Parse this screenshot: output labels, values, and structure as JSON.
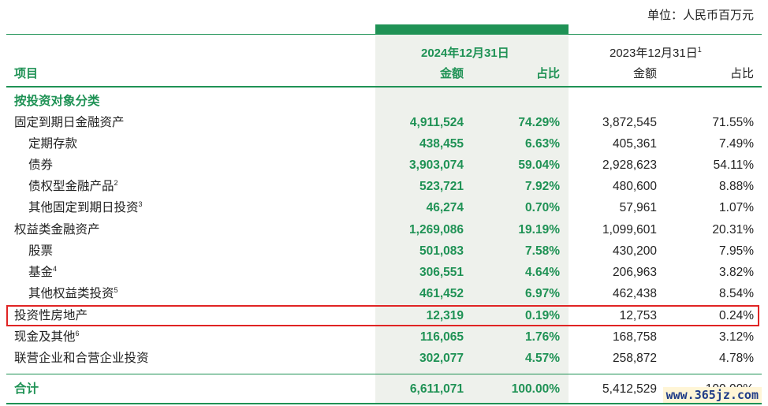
{
  "unit": "单位：人民币百万元",
  "header": {
    "item": "项目",
    "period_2024": "2024年12月31日",
    "period_2023": "2023年12月31日",
    "period_2023_note": "1",
    "amount": "金额",
    "ratio": "占比"
  },
  "rows": [
    {
      "label": "按投资对象分类",
      "note": "",
      "a24": "",
      "p24": "",
      "a23": "",
      "p23": ""
    },
    {
      "label": "固定到期日金融资产",
      "note": "",
      "a24": "4,911,524",
      "p24": "74.29%",
      "a23": "3,872,545",
      "p23": "71.55%"
    },
    {
      "label": "定期存款",
      "note": "",
      "a24": "438,455",
      "p24": "6.63%",
      "a23": "405,361",
      "p23": "7.49%"
    },
    {
      "label": "债券",
      "note": "",
      "a24": "3,903,074",
      "p24": "59.04%",
      "a23": "2,928,623",
      "p23": "54.11%"
    },
    {
      "label": "债权型金融产品",
      "note": "2",
      "a24": "523,721",
      "p24": "7.92%",
      "a23": "480,600",
      "p23": "8.88%"
    },
    {
      "label": "其他固定到期日投资",
      "note": "3",
      "a24": "46,274",
      "p24": "0.70%",
      "a23": "57,961",
      "p23": "1.07%"
    },
    {
      "label": "权益类金融资产",
      "note": "",
      "a24": "1,269,086",
      "p24": "19.19%",
      "a23": "1,099,601",
      "p23": "20.31%"
    },
    {
      "label": "股票",
      "note": "",
      "a24": "501,083",
      "p24": "7.58%",
      "a23": "430,200",
      "p23": "7.95%"
    },
    {
      "label": "基金",
      "note": "4",
      "a24": "306,551",
      "p24": "4.64%",
      "a23": "206,963",
      "p23": "3.82%"
    },
    {
      "label": "其他权益类投资",
      "note": "5",
      "a24": "461,452",
      "p24": "6.97%",
      "a23": "462,438",
      "p23": "8.54%"
    },
    {
      "label": "投资性房地产",
      "note": "",
      "a24": "12,319",
      "p24": "0.19%",
      "a23": "12,753",
      "p23": "0.24%"
    },
    {
      "label": "现金及其他",
      "note": "6",
      "a24": "116,065",
      "p24": "1.76%",
      "a23": "168,758",
      "p23": "3.12%"
    },
    {
      "label": "联营企业和合营企业投资",
      "note": "",
      "a24": "302,077",
      "p24": "4.57%",
      "a23": "258,872",
      "p23": "4.78%"
    },
    {
      "label": "合计",
      "note": "",
      "a24": "6,611,071",
      "p24": "100.00%",
      "a23": "5,412,529",
      "p23": "100.00%"
    }
  ],
  "watermark": "www.365jz.com",
  "colors": {
    "accent": "#1f9255",
    "highlight_bg": "#eef1ec",
    "box": "#e02424"
  }
}
